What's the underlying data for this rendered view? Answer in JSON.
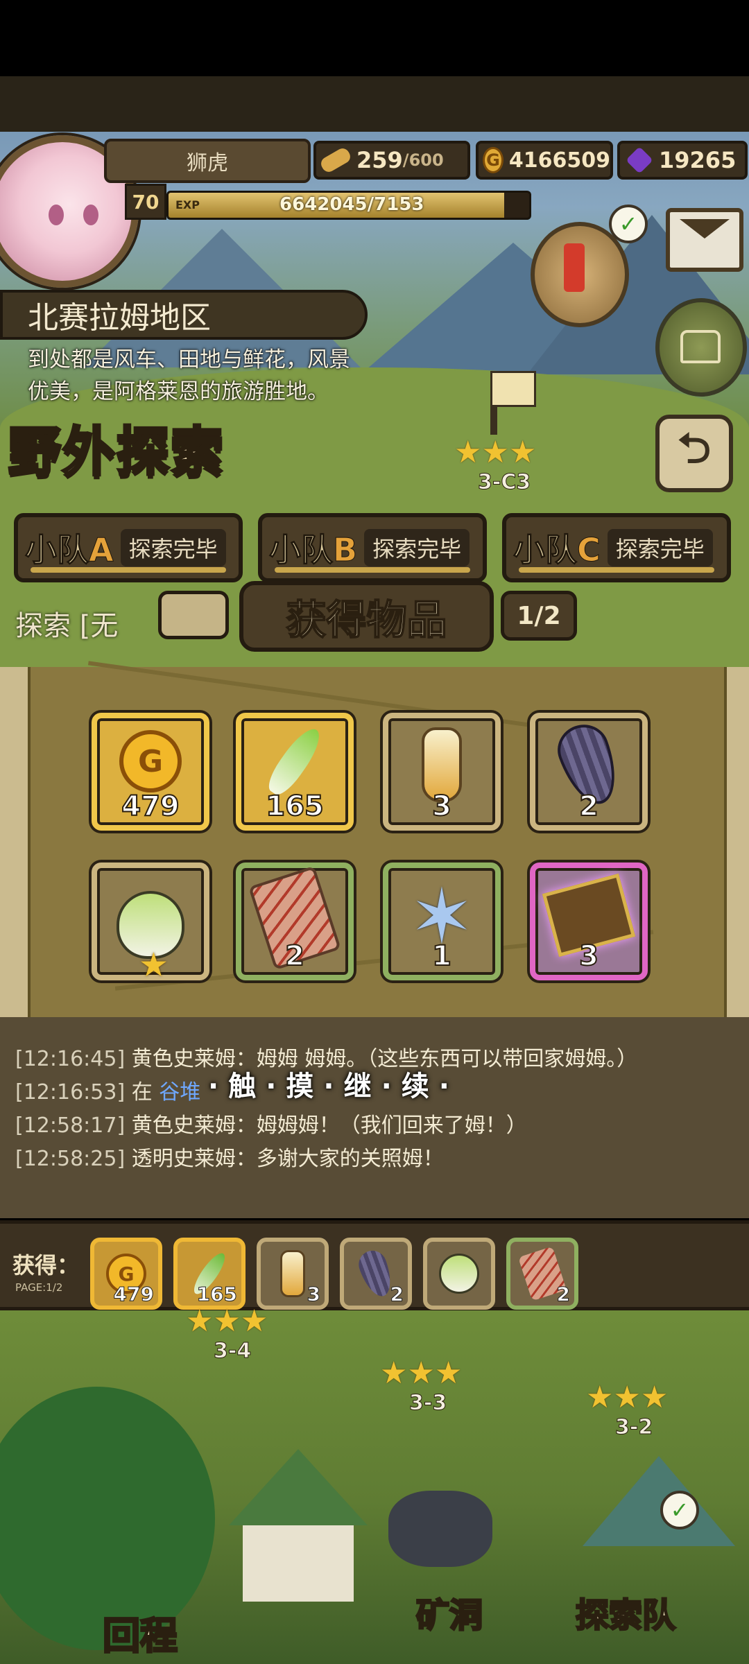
{
  "player": {
    "name": "狮虎",
    "level": "70",
    "exp_tag": "EXP",
    "exp_text": "6642045/7153",
    "exp_progress": 0.93
  },
  "resources": {
    "stamina": "259",
    "stamina_max": "/600",
    "gold": "4166509",
    "gems": "19265"
  },
  "region": {
    "name": "北赛拉姆地区",
    "description_line1": "到处都是风车、田地与鲜花，风景",
    "description_line2": "优美，是阿格莱恩的旅游胜地。"
  },
  "screen_title": "野外探索",
  "stages": [
    {
      "label": "3-C3",
      "stars": "★★★"
    },
    {
      "label": "3-4",
      "stars": "★★★"
    },
    {
      "label": "3-3",
      "stars": "★★★"
    },
    {
      "label": "3-2",
      "stars": "★★★"
    }
  ],
  "teams": [
    {
      "name_prefix": "小队",
      "letter": "A",
      "status": "探索完毕"
    },
    {
      "name_prefix": "小队",
      "letter": "B",
      "status": "探索完毕"
    },
    {
      "name_prefix": "小队",
      "letter": "C",
      "status": "探索完毕"
    }
  ],
  "explore_label": "探索 [无",
  "popup": {
    "title": "获得物品",
    "page": "1/2",
    "touch_continue": "·触·摸·继·续·"
  },
  "items": [
    {
      "name": "gold-coin",
      "count": "479",
      "rarity": "gold"
    },
    {
      "name": "feather",
      "count": "165",
      "rarity": "gold"
    },
    {
      "name": "potion-bottle",
      "count": "3",
      "rarity": "normal"
    },
    {
      "name": "seed",
      "count": "2",
      "rarity": "normal"
    },
    {
      "name": "bulb-sprout",
      "count": "",
      "rarity": "normal"
    },
    {
      "name": "fish-tag",
      "count": "2",
      "rarity": "green"
    },
    {
      "name": "blue-flower",
      "count": "1",
      "rarity": "green"
    },
    {
      "name": "magic-book",
      "count": "3",
      "rarity": "purple"
    }
  ],
  "log": [
    {
      "time": "[12:16:45]",
      "text": "黄色史莱姆：姆姆 姆姆。（这些东西可以带回家姆姆。）"
    },
    {
      "time": "[12:16:53]",
      "prefix": "在 ",
      "place": "谷堆",
      "text": ""
    },
    {
      "time": "[12:58:17]",
      "text": "黄色史莱姆：姆姆姆！（我们回来了姆！）"
    },
    {
      "time": "[12:58:25]",
      "text": "透明史莱姆：多谢大家的关照姆！"
    }
  ],
  "gained": {
    "label": "获得：",
    "page": "PAGE:1/2",
    "items": [
      {
        "name": "gold-coin",
        "count": "479"
      },
      {
        "name": "feather",
        "count": "165"
      },
      {
        "name": "potion-bottle",
        "count": "3"
      },
      {
        "name": "seed",
        "count": "2"
      },
      {
        "name": "bulb-sprout",
        "count": ""
      },
      {
        "name": "fish-tag",
        "count": "2"
      }
    ]
  },
  "bottom": {
    "return": "回程",
    "mine": "矿洞",
    "team": "探索队"
  },
  "colors": {
    "gold_rarity": "#f0c74a",
    "green_rarity": "#8fb060",
    "purple_rarity": "#e066c4",
    "star": "#f1c231",
    "place_link": "#6fa8ff"
  }
}
